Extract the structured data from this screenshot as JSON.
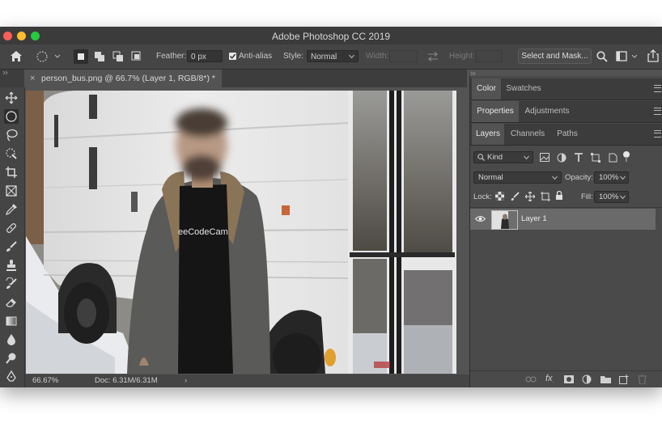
{
  "window": {
    "title": "Adobe Photoshop CC 2019"
  },
  "options_bar": {
    "feather_label": "Feather:",
    "feather_value": "0 px",
    "antialias_label": "Anti-alias",
    "antialias_checked": true,
    "style_label": "Style:",
    "style_value": "Normal",
    "width_label": "Width:",
    "height_label": "Height:",
    "select_mask_label": "Select and Mask..."
  },
  "document": {
    "tab_label": "person_bus.png @ 66.7% (Layer 1, RGB/8*) *",
    "zoom": "66.67%",
    "doc_size": "Doc: 6.31M/6.31M",
    "shirt_text": "eeCodeCam"
  },
  "panels": {
    "top_tabs": [
      "Color",
      "Swatches"
    ],
    "mid_tabs": [
      "Properties",
      "Adjustments"
    ],
    "layers_tabs": [
      "Layers",
      "Channels",
      "Paths"
    ]
  },
  "layers": {
    "filter_kind": "Kind",
    "blend_mode": "Normal",
    "opacity_label": "Opacity:",
    "opacity_value": "100%",
    "lock_label": "Lock:",
    "fill_label": "Fill:",
    "fill_value": "100%",
    "items": [
      {
        "name": "Layer 1",
        "visible": true
      }
    ]
  },
  "colors": {
    "accent_red": "#ff5f57",
    "accent_yellow": "#febc2e",
    "accent_green": "#28c840"
  }
}
